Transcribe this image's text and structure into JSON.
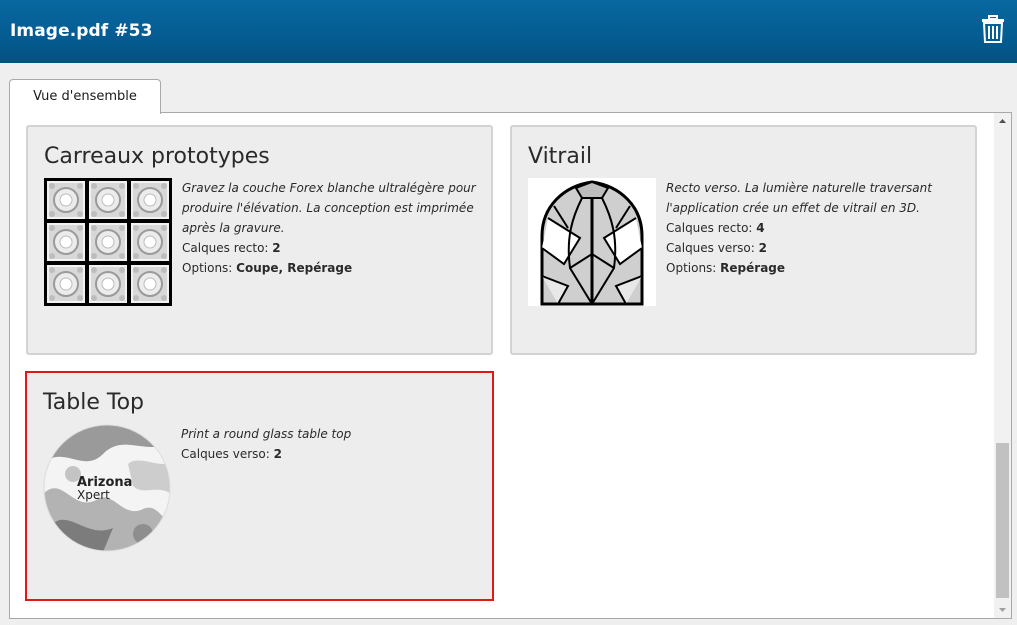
{
  "header": {
    "title": "Image.pdf #53",
    "delete_icon": "trash-icon"
  },
  "tabs": [
    {
      "label": "Vue d'ensemble",
      "active": true
    }
  ],
  "cards": [
    {
      "title": "Carreaux prototypes",
      "thumbnail": "tile-grid-image",
      "description": "Gravez la couche Forex blanche ultralégère pour produire l'élévation. La conception est imprimée après la gravure.",
      "rows": [
        {
          "label": "Calques recto: ",
          "value": "2"
        },
        {
          "label": "Options: ",
          "value": "Coupe, Repérage"
        }
      ]
    },
    {
      "title": "Vitrail",
      "thumbnail": "stained-glass-window-image",
      "description": "Recto verso. La lumière naturelle traversant l'application crée un effet de vitrail en 3D.",
      "rows": [
        {
          "label": "Calques recto: ",
          "value": "4"
        },
        {
          "label": "Calques verso: ",
          "value": "2"
        },
        {
          "label": "Options: ",
          "value": "Repérage"
        }
      ]
    },
    {
      "title": "Table Top",
      "thumbnail": "round-table-top-image",
      "thumbnail_text": [
        "Arizona",
        "Xpert"
      ],
      "description": "Print a round glass table top",
      "rows": [
        {
          "label": "Calques verso: ",
          "value": "2"
        }
      ],
      "selected": true
    }
  ],
  "colors": {
    "header": "#045d93",
    "selection_border": "#e01818",
    "card_background": "#ededed"
  }
}
